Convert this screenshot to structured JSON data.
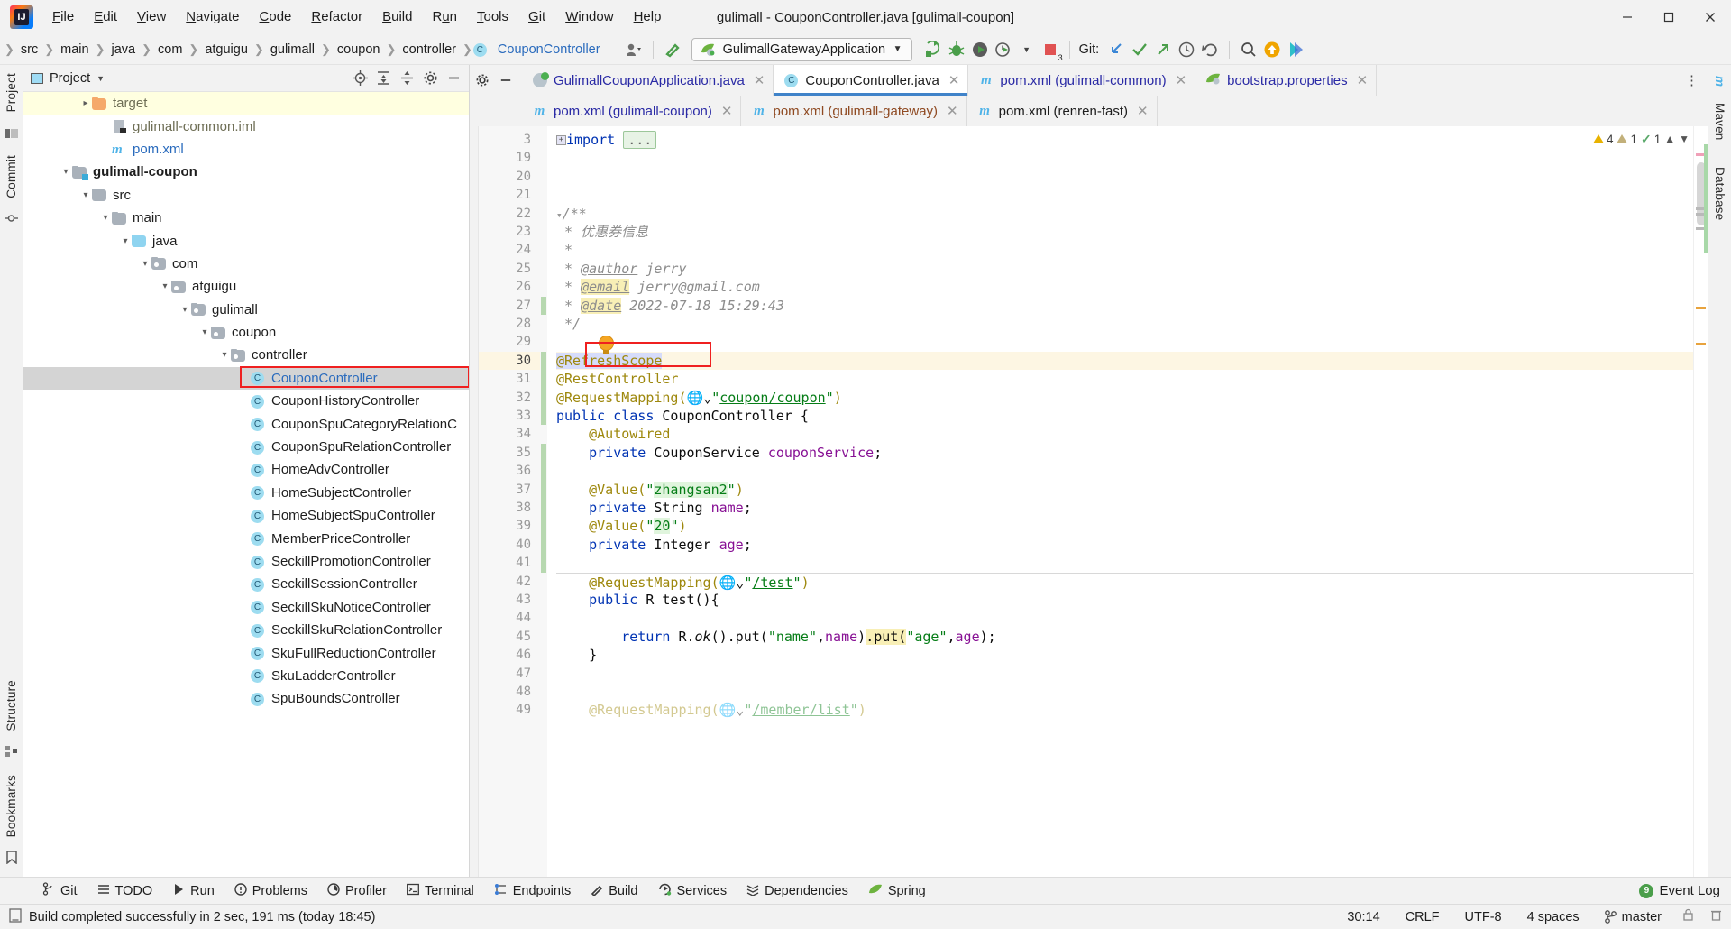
{
  "window": {
    "title": "gulimall - CouponController.java [gulimall-coupon]",
    "app_icon": "intellij-idea-logo",
    "controls": [
      "minimize",
      "maximize",
      "close"
    ]
  },
  "menubar": {
    "items": [
      {
        "label": "File",
        "mnemonic": "F"
      },
      {
        "label": "Edit",
        "mnemonic": "E"
      },
      {
        "label": "View",
        "mnemonic": "V"
      },
      {
        "label": "Navigate",
        "mnemonic": "N"
      },
      {
        "label": "Code",
        "mnemonic": "C"
      },
      {
        "label": "Refactor",
        "mnemonic": "R"
      },
      {
        "label": "Build",
        "mnemonic": "B"
      },
      {
        "label": "Run",
        "mnemonic": "u"
      },
      {
        "label": "Tools",
        "mnemonic": "T"
      },
      {
        "label": "Git",
        "mnemonic": "G"
      },
      {
        "label": "Window",
        "mnemonic": "W"
      },
      {
        "label": "Help",
        "mnemonic": "H"
      }
    ]
  },
  "navbar": {
    "breadcrumbs": [
      "src",
      "main",
      "java",
      "com",
      "atguigu",
      "gulimall",
      "coupon",
      "controller"
    ],
    "current_class": "CouponController",
    "run_config": "GulimallGatewayApplication",
    "git_label": "Git:",
    "stop_badge": "3"
  },
  "project_panel": {
    "title": "Project",
    "tree": [
      {
        "label": "target",
        "indent": 3,
        "twist": "right",
        "icon": "folder-orange",
        "style": "dim",
        "row": "highlight"
      },
      {
        "label": "gulimall-common.iml",
        "indent": 4,
        "twist": "",
        "icon": "file-iml",
        "style": "dim",
        "row": ""
      },
      {
        "label": "pom.xml",
        "indent": 4,
        "twist": "",
        "icon": "maven-m",
        "style": "blue",
        "row": ""
      },
      {
        "label": "gulimall-coupon",
        "indent": 2,
        "twist": "down",
        "icon": "folder-module",
        "style": "bold",
        "row": ""
      },
      {
        "label": "src",
        "indent": 3,
        "twist": "down",
        "icon": "folder",
        "style": "",
        "row": ""
      },
      {
        "label": "main",
        "indent": 4,
        "twist": "down",
        "icon": "folder",
        "style": "",
        "row": ""
      },
      {
        "label": "java",
        "indent": 5,
        "twist": "down",
        "icon": "folder-blue",
        "style": "",
        "row": ""
      },
      {
        "label": "com",
        "indent": 6,
        "twist": "down",
        "icon": "folder-pkg",
        "style": "",
        "row": ""
      },
      {
        "label": "atguigu",
        "indent": 7,
        "twist": "down",
        "icon": "folder-pkg",
        "style": "",
        "row": ""
      },
      {
        "label": "gulimall",
        "indent": 8,
        "twist": "down",
        "icon": "folder-pkg",
        "style": "",
        "row": ""
      },
      {
        "label": "coupon",
        "indent": 9,
        "twist": "down",
        "icon": "folder-pkg",
        "style": "",
        "row": ""
      },
      {
        "label": "controller",
        "indent": 10,
        "twist": "down",
        "icon": "folder-pkg",
        "style": "",
        "row": ""
      },
      {
        "label": "CouponController",
        "indent": 11,
        "twist": "",
        "icon": "java-class",
        "style": "blue",
        "row": "selected"
      },
      {
        "label": "CouponHistoryController",
        "indent": 11,
        "twist": "",
        "icon": "java-class",
        "style": "",
        "row": ""
      },
      {
        "label": "CouponSpuCategoryRelationC",
        "indent": 11,
        "twist": "",
        "icon": "java-class",
        "style": "",
        "row": ""
      },
      {
        "label": "CouponSpuRelationController",
        "indent": 11,
        "twist": "",
        "icon": "java-class",
        "style": "",
        "row": ""
      },
      {
        "label": "HomeAdvController",
        "indent": 11,
        "twist": "",
        "icon": "java-class",
        "style": "",
        "row": ""
      },
      {
        "label": "HomeSubjectController",
        "indent": 11,
        "twist": "",
        "icon": "java-class",
        "style": "",
        "row": ""
      },
      {
        "label": "HomeSubjectSpuController",
        "indent": 11,
        "twist": "",
        "icon": "java-class",
        "style": "",
        "row": ""
      },
      {
        "label": "MemberPriceController",
        "indent": 11,
        "twist": "",
        "icon": "java-class",
        "style": "",
        "row": ""
      },
      {
        "label": "SeckillPromotionController",
        "indent": 11,
        "twist": "",
        "icon": "java-class",
        "style": "",
        "row": ""
      },
      {
        "label": "SeckillSessionController",
        "indent": 11,
        "twist": "",
        "icon": "java-class",
        "style": "",
        "row": ""
      },
      {
        "label": "SeckillSkuNoticeController",
        "indent": 11,
        "twist": "",
        "icon": "java-class",
        "style": "",
        "row": ""
      },
      {
        "label": "SeckillSkuRelationController",
        "indent": 11,
        "twist": "",
        "icon": "java-class",
        "style": "",
        "row": ""
      },
      {
        "label": "SkuFullReductionController",
        "indent": 11,
        "twist": "",
        "icon": "java-class",
        "style": "",
        "row": ""
      },
      {
        "label": "SkuLadderController",
        "indent": 11,
        "twist": "",
        "icon": "java-class",
        "style": "",
        "row": ""
      },
      {
        "label": "SpuBoundsController",
        "indent": 11,
        "twist": "",
        "icon": "java-class",
        "style": "",
        "row": ""
      }
    ]
  },
  "left_rail": {
    "top": [
      "Project"
    ],
    "middle": [
      "Commit"
    ],
    "bottom": [
      "Structure",
      "Bookmarks"
    ]
  },
  "right_rail": {
    "items": [
      "m",
      "Maven",
      "Database"
    ]
  },
  "editor": {
    "tabs_row1": [
      {
        "label": "GulimallCouponApplication.java",
        "icon": "spring-app",
        "active": false,
        "color": "blue"
      },
      {
        "label": "CouponController.java",
        "icon": "java-class",
        "active": true,
        "color": "default"
      },
      {
        "label": "pom.xml (gulimall-common)",
        "icon": "maven-m",
        "active": false,
        "color": "blue"
      },
      {
        "label": "bootstrap.properties",
        "icon": "spring-leaf",
        "active": false,
        "color": "blue"
      }
    ],
    "tabs_row2": [
      {
        "label": "pom.xml (gulimall-coupon)",
        "icon": "maven-m",
        "active": false,
        "color": "blue"
      },
      {
        "label": "pom.xml (gulimall-gateway)",
        "icon": "maven-m",
        "active": false,
        "color": "brown"
      },
      {
        "label": "pom.xml (renren-fast)",
        "icon": "maven-m",
        "active": false,
        "color": "default"
      }
    ],
    "inspections": {
      "warnings": "4",
      "weak_warnings": "1",
      "typos": "1"
    },
    "highlighted_annotation": "@RefreshScope",
    "lines": [
      {
        "no": "3",
        "folded": true,
        "html": "<span class=\"fold-box\">+</span><span class=\"kw\">import</span> <span class=\"import-dots\">...</span>"
      },
      {
        "no": "19",
        "html": ""
      },
      {
        "no": "20",
        "html": ""
      },
      {
        "no": "21",
        "html": ""
      },
      {
        "no": "22",
        "html": "<span class=\"fold-ico\">&#9662;</span><span class=\"cmt\">/**</span>"
      },
      {
        "no": "23",
        "html": " <span class=\"cmt\">* 优惠券信息</span>"
      },
      {
        "no": "24",
        "html": " <span class=\"cmt\">*</span>"
      },
      {
        "no": "25",
        "html": " <span class=\"cmt\">* </span><span class=\"cmt-tag\">@author</span><span class=\"cmt\"> jerry</span>"
      },
      {
        "no": "26",
        "html": " <span class=\"cmt\">* </span><span class=\"cmt-tag hl-usage\">@email</span><span class=\"cmt\"> jerry@gmail.com</span>"
      },
      {
        "no": "27",
        "html": " <span class=\"cmt\">* </span><span class=\"cmt-tag hl-usage\">@date</span><span class=\"cmt\"> 2022-07-18 15:29:43</span>"
      },
      {
        "no": "28",
        "html": " <span class=\"cmt\">*/</span>"
      },
      {
        "no": "29",
        "html": ""
      },
      {
        "no": "30",
        "hl": true,
        "html": "<span class=\"ann hl-sel\">@RefreshScope</span>"
      },
      {
        "no": "31",
        "html": "<span class=\"ann\">@RestController</span>"
      },
      {
        "no": "32",
        "html": "<span class=\"ann\">@RequestMapping(</span><span class=\"globe\">&#127760;&#8964;</span><span class=\"str\">\"</span><span class=\"link-str\">coupon/coupon</span><span class=\"str\">\"</span><span class=\"ann\">)</span>"
      },
      {
        "no": "33",
        "html": "<span class=\"kw\">public class</span> <span class=\"cls-name\">CouponController</span> {"
      },
      {
        "no": "34",
        "html": "    <span class=\"ann\">@Autowired</span>"
      },
      {
        "no": "35",
        "html": "    <span class=\"kw\">private</span> CouponService <span class=\"field\">couponService</span>;"
      },
      {
        "no": "36",
        "html": ""
      },
      {
        "no": "37",
        "html": "    <span class=\"ann\">@Value(</span><span class=\"str\">\"</span><span class=\"str hl-green\">zhangsan2</span><span class=\"str\">\"</span><span class=\"ann\">)</span>"
      },
      {
        "no": "38",
        "html": "    <span class=\"kw\">private</span> String <span class=\"field\">name</span>;"
      },
      {
        "no": "39",
        "html": "    <span class=\"ann\">@Value(</span><span class=\"str\">\"</span><span class=\"str hl-green\">20</span><span class=\"str\">\"</span><span class=\"ann\">)</span>"
      },
      {
        "no": "40",
        "html": "    <span class=\"kw\">private</span> Integer <span class=\"field\">age</span>;"
      },
      {
        "no": "41",
        "html": ""
      },
      {
        "no": "42",
        "sep": true,
        "html": "    <span class=\"ann\">@RequestMapping(</span><span class=\"globe\">&#127760;&#8964;</span><span class=\"str\">\"</span><span class=\"link-str\">/test</span><span class=\"str\">\"</span><span class=\"ann\">)</span>"
      },
      {
        "no": "43",
        "html": "    <span class=\"kw\">public</span> R <span class=\"meth\">test</span>(){"
      },
      {
        "no": "44",
        "html": ""
      },
      {
        "no": "45",
        "html": "        <span class=\"kw\">return</span> R.<span class=\"cmt\" style=\"font-style:italic;color:#0c0c0c\">ok</span>().put(<span class=\"str\">\"name\"</span>,<span class=\"field\">name</span>)<span class=\"hl-usage\">.put(</span><span class=\"str\">\"age\"</span>,<span class=\"field\">age</span>);"
      },
      {
        "no": "46",
        "html": "    }"
      },
      {
        "no": "47",
        "html": ""
      },
      {
        "no": "48",
        "html": ""
      },
      {
        "no": "49",
        "faded": true,
        "html": "    <span class=\"ann\">@RequestMapping(</span><span class=\"globe\">&#127760;&#8964;</span><span class=\"str\">\"</span><span class=\"link-str\">/member/list</span><span class=\"str\">\"</span><span class=\"ann\">)</span>"
      }
    ]
  },
  "bottom_bar": {
    "items": [
      {
        "label": "Git",
        "icon": "git-branch-icon"
      },
      {
        "label": "TODO",
        "icon": "todo-list-icon"
      },
      {
        "label": "Run",
        "icon": "run-play-icon"
      },
      {
        "label": "Problems",
        "icon": "problems-icon"
      },
      {
        "label": "Profiler",
        "icon": "profiler-icon"
      },
      {
        "label": "Terminal",
        "icon": "terminal-icon"
      },
      {
        "label": "Endpoints",
        "icon": "endpoints-icon"
      },
      {
        "label": "Build",
        "icon": "build-hammer-icon"
      },
      {
        "label": "Services",
        "icon": "services-icon"
      },
      {
        "label": "Dependencies",
        "icon": "dependencies-icon"
      },
      {
        "label": "Spring",
        "icon": "spring-leaf-icon"
      }
    ],
    "event_log": {
      "label": "Event Log",
      "badge": "9"
    }
  },
  "status_bar": {
    "message": "Build completed successfully in 2 sec, 191 ms (today 18:45)",
    "caret": "30:14",
    "line_separator": "CRLF",
    "encoding": "UTF-8",
    "indent": "4 spaces",
    "branch": "master"
  }
}
